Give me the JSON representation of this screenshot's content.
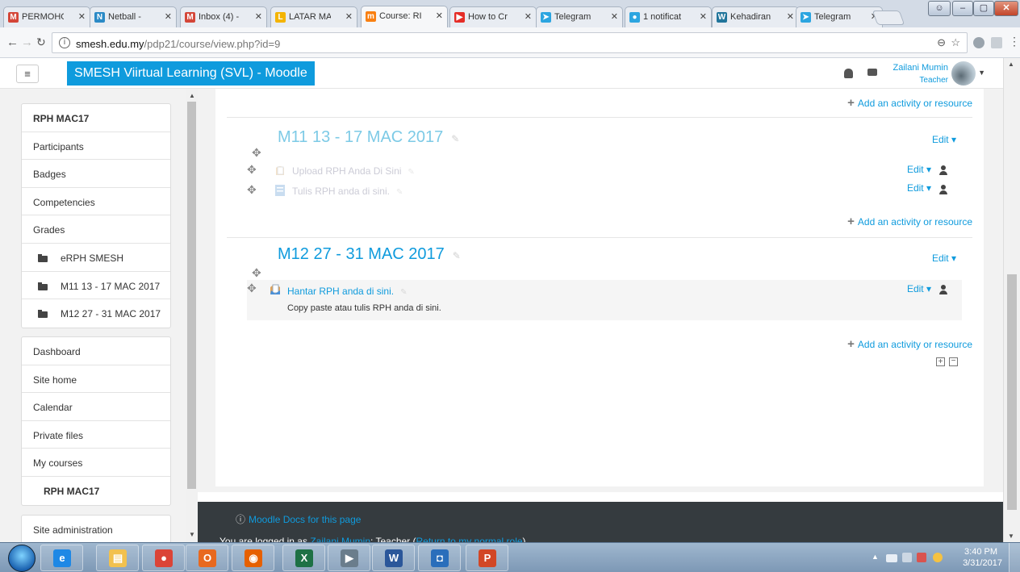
{
  "browser": {
    "tabs": [
      {
        "label": "PERMOHO",
        "icon_color": "#d44638",
        "glyph": "M"
      },
      {
        "label": "Netball -",
        "icon_color": "#2b8ac6",
        "glyph": "N"
      },
      {
        "label": "Inbox (4) -",
        "icon_color": "#d44638",
        "glyph": "M"
      },
      {
        "label": "LATAR MA",
        "icon_color": "#f4b400",
        "glyph": "L"
      },
      {
        "label": "Course: RI",
        "icon_color": "#f98012",
        "glyph": "m"
      },
      {
        "label": "How to Cr",
        "icon_color": "#e52d27",
        "glyph": "▶"
      },
      {
        "label": "Telegram",
        "icon_color": "#2ca5e0",
        "glyph": "➤"
      },
      {
        "label": "1 notificat",
        "icon_color": "#2ca5e0",
        "glyph": "●"
      },
      {
        "label": "Kehadiran",
        "icon_color": "#21759b",
        "glyph": "W"
      },
      {
        "label": "Telegram",
        "icon_color": "#2ca5e0",
        "glyph": "➤"
      }
    ],
    "url_host": "smesh.edu.my",
    "url_path": "/pdp21/course/view.php?id=9"
  },
  "navbar": {
    "menu_icon": "≡",
    "brand": "SMESH Viirtual Learning (SVL) - Moodle",
    "user_name": "Zailani Mumin",
    "user_role": "Teacher"
  },
  "drawer": {
    "course_group": [
      {
        "label": "RPH MAC17",
        "style": "bold"
      },
      {
        "label": "Participants",
        "style": ""
      },
      {
        "label": "Badges",
        "style": ""
      },
      {
        "label": "Competencies",
        "style": ""
      },
      {
        "label": "Grades",
        "style": ""
      },
      {
        "label": "eRPH SMESH",
        "style": "folder"
      },
      {
        "label": "M11 13 - 17 MAC 2017",
        "style": "folder"
      },
      {
        "label": "M12 27 - 31 MAC 2017",
        "style": "folder"
      }
    ],
    "site_group": [
      {
        "label": "Dashboard",
        "style": ""
      },
      {
        "label": "Site home",
        "style": ""
      },
      {
        "label": "Calendar",
        "style": ""
      },
      {
        "label": "Private files",
        "style": ""
      },
      {
        "label": "My courses",
        "style": ""
      },
      {
        "label": "RPH MAC17",
        "style": "bold-indent"
      }
    ],
    "admin_group": [
      {
        "label": "Site administration",
        "style": ""
      }
    ]
  },
  "content": {
    "add_activity": "Add an activity or resource",
    "edit": "Edit",
    "sections": [
      {
        "title": "M11 13 - 17 MAC 2017",
        "hidden": true,
        "activities": [
          {
            "name": "Upload RPH Anda Di Sini",
            "icon": "assignment-icon"
          },
          {
            "name": "Tulis RPH anda di sini.",
            "icon": "page-icon"
          }
        ]
      },
      {
        "title": "M12 27 - 31 MAC 2017",
        "hidden": false,
        "activities": [
          {
            "name": "Hantar RPH anda di sini.",
            "icon": "assignment-icon",
            "description": "Copy paste atau tulis RPH anda di sini."
          }
        ]
      }
    ]
  },
  "footer": {
    "docs_link": "Moodle Docs for this page",
    "login_prefix": "You are logged in as ",
    "login_user": "Zailani Mumin",
    "login_role": ": Teacher (",
    "return_link": "Return to my normal role",
    "login_suffix": ")"
  },
  "taskbar": {
    "apps": [
      {
        "name": "ie-icon",
        "color": "#1e88e5",
        "glyph": "e"
      },
      {
        "name": "explorer-icon",
        "color": "#f2c14e",
        "glyph": "▤"
      },
      {
        "name": "chrome-icon",
        "color": "#db4437",
        "glyph": "●"
      },
      {
        "name": "outlook-icon",
        "color": "#e8691f",
        "glyph": "O"
      },
      {
        "name": "firefox-icon",
        "color": "#e66000",
        "glyph": "◉"
      },
      {
        "name": "excel-icon",
        "color": "#1e7145",
        "glyph": "X"
      },
      {
        "name": "media-icon",
        "color": "#6a7d8c",
        "glyph": "▶"
      },
      {
        "name": "word-icon",
        "color": "#2b579a",
        "glyph": "W"
      },
      {
        "name": "dialog-icon",
        "color": "#2a6ebb",
        "glyph": "◘"
      },
      {
        "name": "powerpoint-icon",
        "color": "#d24726",
        "glyph": "P"
      }
    ],
    "time": "3:40 PM",
    "date": "3/31/2017"
  }
}
